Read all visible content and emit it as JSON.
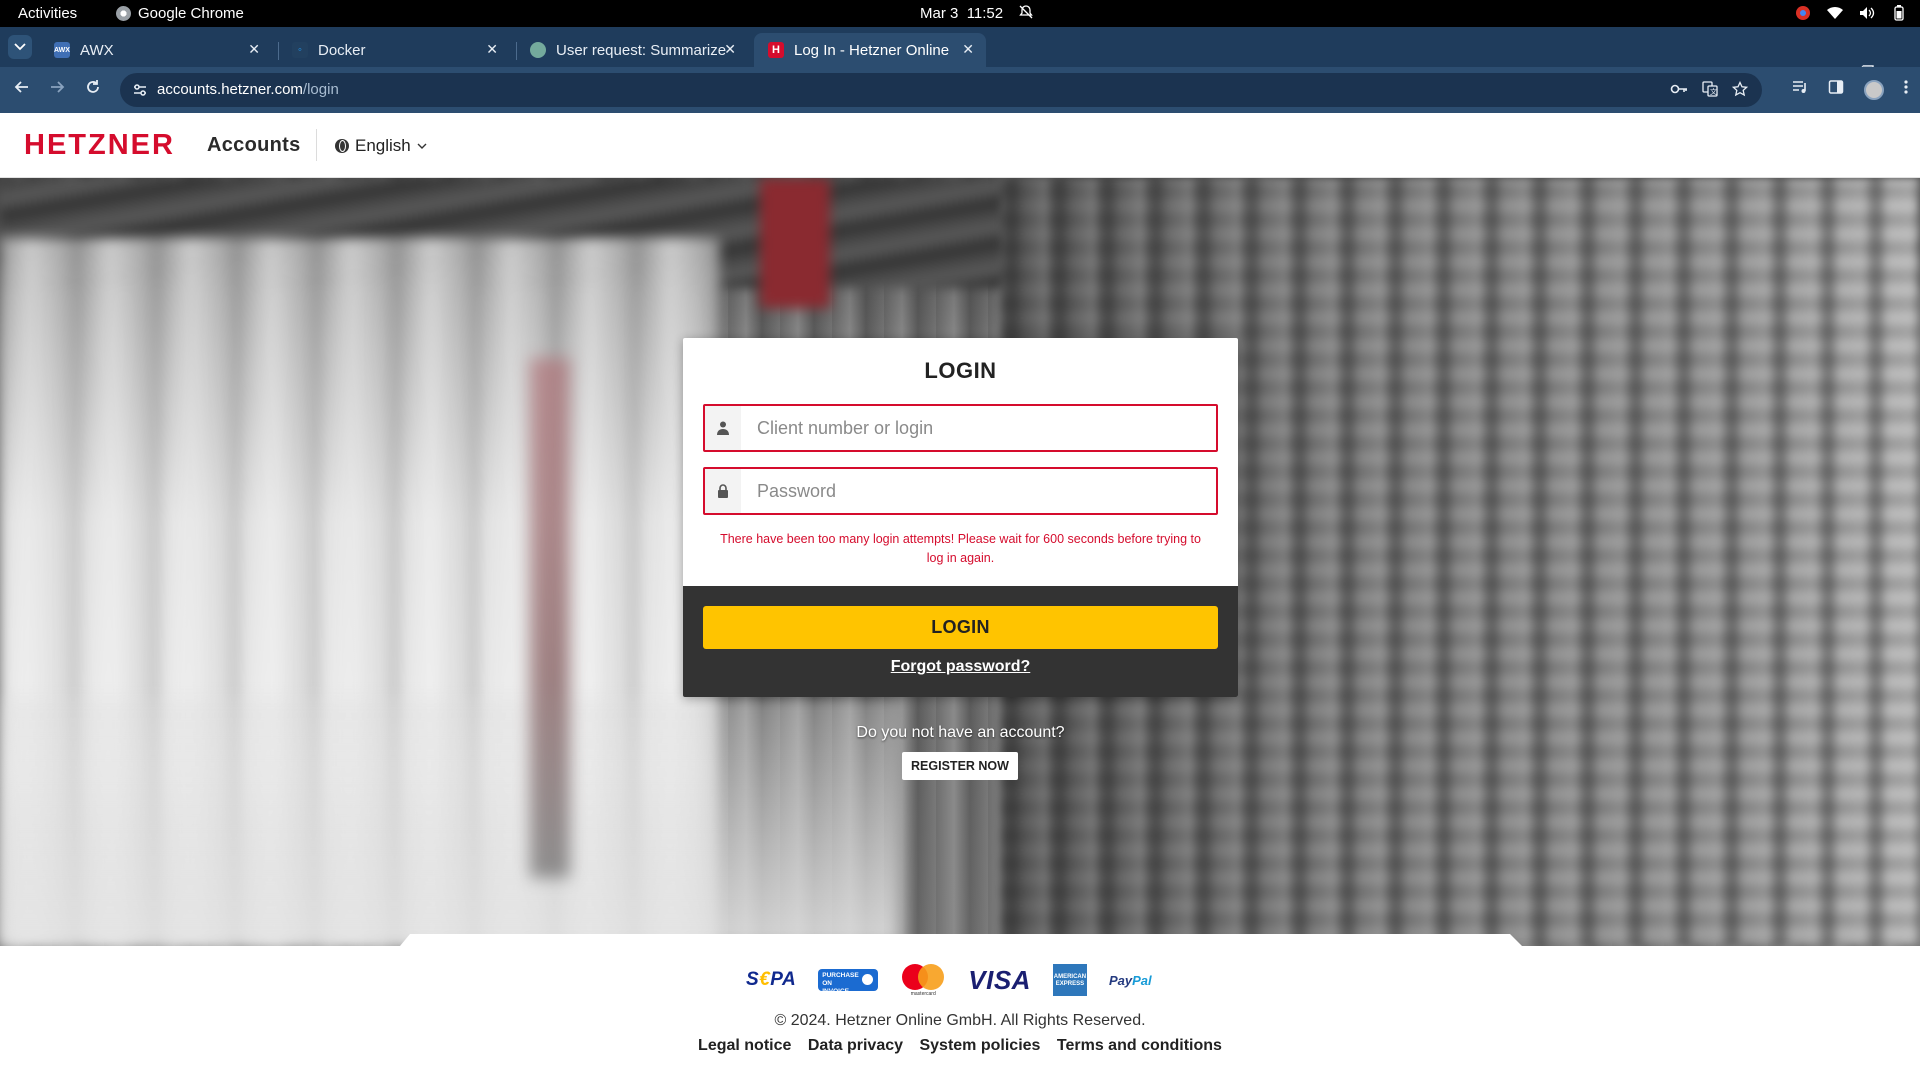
{
  "system_bar": {
    "activities": "Activities",
    "app_name": "Google Chrome",
    "date": "Mar 3",
    "time": "11:52"
  },
  "browser": {
    "tabs": [
      {
        "title": "AWX",
        "favicon": "awx-icon",
        "active": false
      },
      {
        "title": "Docker",
        "favicon": "docker-icon",
        "active": false
      },
      {
        "title": "User request: Summarize",
        "favicon": "openai-icon",
        "active": false
      },
      {
        "title": "Log In - Hetzner Online",
        "favicon": "hetzner-icon",
        "active": true
      }
    ],
    "url_host": "accounts.hetzner.com",
    "url_path": "/login"
  },
  "header": {
    "brand": "HETZNER",
    "section": "Accounts",
    "language": "English"
  },
  "login": {
    "title": "LOGIN",
    "username_placeholder": "Client number or login",
    "password_placeholder": "Password",
    "error_message": "There have been too many login attempts! Please wait for 600 seconds before trying to log in again.",
    "submit_label": "LOGIN",
    "forgot_label": "Forgot password?",
    "no_account_text": "Do you not have an account?",
    "register_label": "REGISTER NOW"
  },
  "footer": {
    "payment_methods": {
      "sepa_left": "S",
      "sepa_e": "€",
      "sepa_right": "PA",
      "invoice": "PURCHASE ON INVOICE",
      "mastercard": "mastercard",
      "visa": "VISA",
      "amex": "AMERICAN EXPRESS",
      "paypal_pay": "Pay",
      "paypal_pal": "Pal"
    },
    "copyright": "© 2024. Hetzner Online GmbH. All Rights Reserved.",
    "links": [
      "Legal notice",
      "Data privacy",
      "System policies",
      "Terms and conditions"
    ]
  },
  "colors": {
    "brand_red": "#d50c2d",
    "login_button": "#ffc400",
    "card_bottom": "#333333",
    "chrome_frame": "#1f3c5c"
  }
}
